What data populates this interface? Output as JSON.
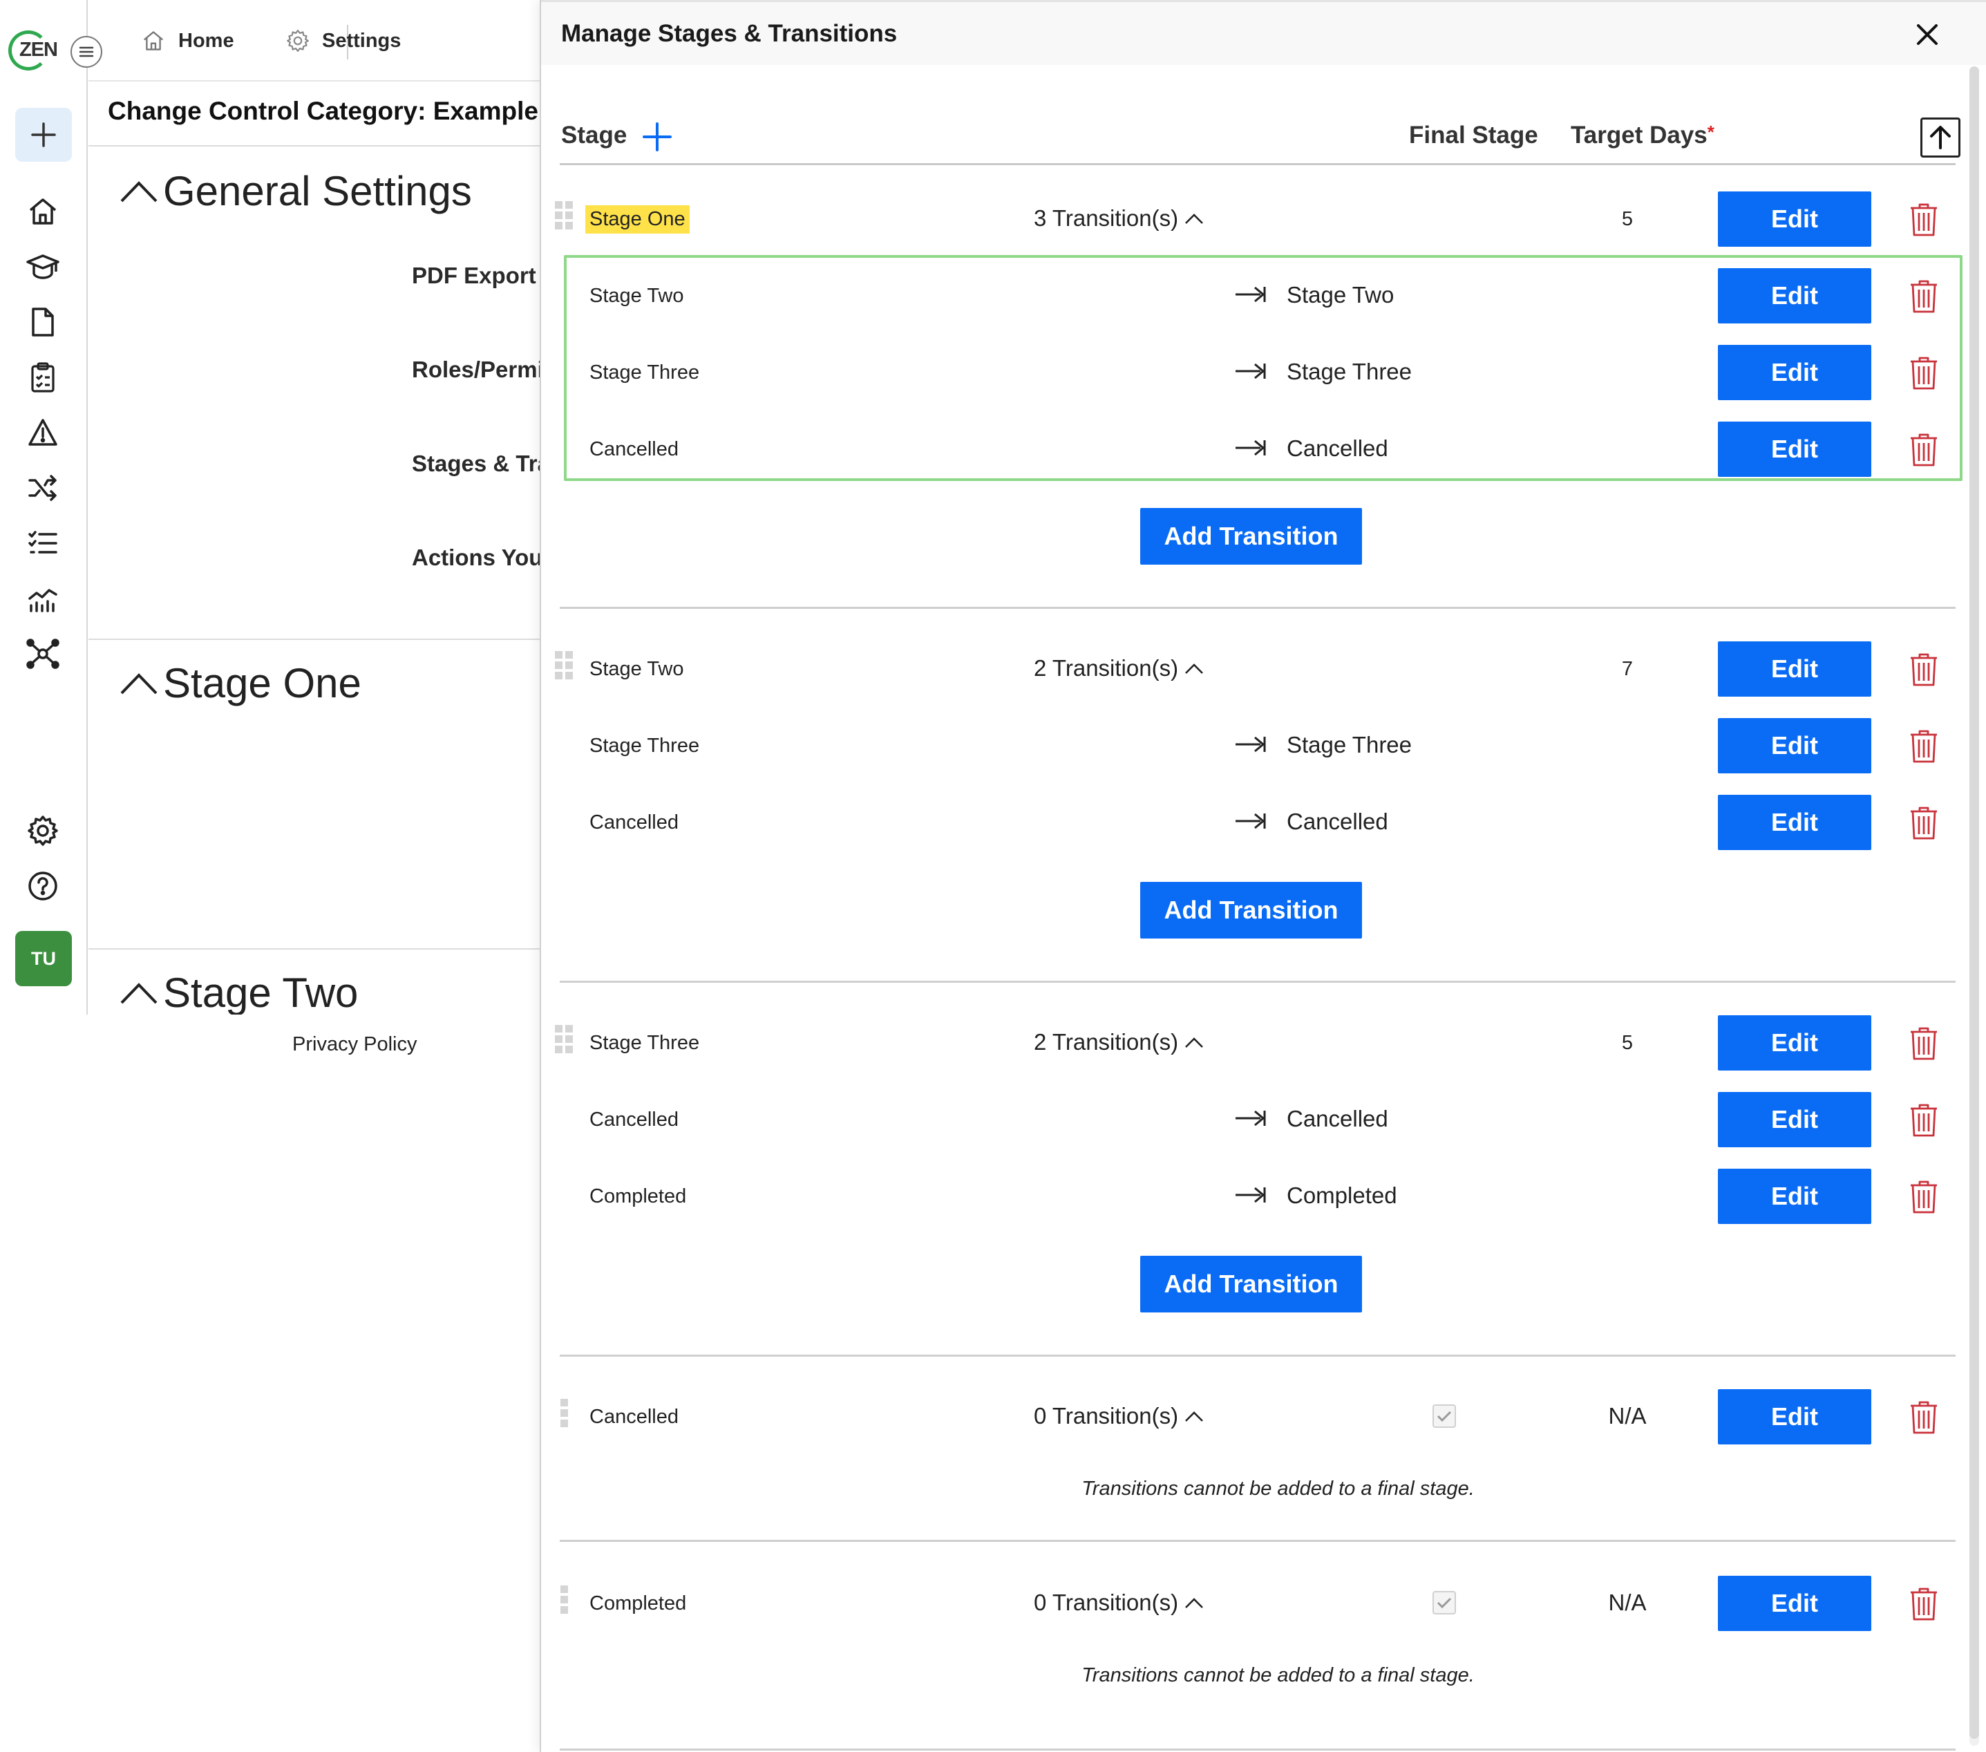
{
  "app": {
    "logo_text": "ZEN",
    "brand_color": "#2fa84f",
    "accent_color": "#0a6cf5",
    "highlight_color": "#ffe24a",
    "user_initials": "TU",
    "rail_icons": [
      "home-icon",
      "graduation-cap-icon",
      "document-icon",
      "clipboard-icon",
      "warning-icon",
      "shuffle-icon",
      "checklist-icon",
      "analytics-icon",
      "network-icon",
      "gear-icon",
      "help-icon"
    ]
  },
  "breadcrumbs": [
    {
      "label": "Home",
      "icon": "home-icon"
    },
    {
      "label": "Settings",
      "icon": "gear-icon"
    }
  ],
  "page": {
    "title": "Change Control Category: Example Cha",
    "sections": [
      {
        "title": "General Settings"
      },
      {
        "title": "Stage One"
      },
      {
        "title": "Stage Two"
      }
    ],
    "settings_items": [
      "PDF Export (",
      "Roles/Permi",
      "Stages & Tra",
      "Actions You"
    ],
    "privacy_policy": "Privacy Policy"
  },
  "modal": {
    "title": "Manage Stages & Transitions",
    "columns": {
      "stage": "Stage",
      "final_stage": "Final Stage",
      "target_days": "Target Days",
      "required_mark": "*"
    },
    "edit_label": "Edit",
    "add_transition_label": "Add Transition",
    "final_stage_note": "Transitions cannot be added to a final stage.",
    "stages": [
      {
        "name": "Stage One",
        "transitions_label": "3 Transition(s)",
        "target_days": "5",
        "final": false,
        "highlighted": true,
        "transitions": [
          {
            "from": "Stage Two",
            "to": "Stage Two"
          },
          {
            "from": "Stage Three",
            "to": "Stage Three"
          },
          {
            "from": "Cancelled",
            "to": "Cancelled"
          }
        ]
      },
      {
        "name": "Stage Two",
        "transitions_label": "2 Transition(s)",
        "target_days": "7",
        "final": false,
        "transitions": [
          {
            "from": "Stage Three",
            "to": "Stage Three"
          },
          {
            "from": "Cancelled",
            "to": "Cancelled"
          }
        ]
      },
      {
        "name": "Stage Three",
        "transitions_label": "2 Transition(s)",
        "target_days": "5",
        "final": false,
        "transitions": [
          {
            "from": "Cancelled",
            "to": "Cancelled"
          },
          {
            "from": "Completed",
            "to": "Completed"
          }
        ]
      },
      {
        "name": "Cancelled",
        "transitions_label": "0 Transition(s)",
        "target_days": "N/A",
        "final": true,
        "transitions": []
      },
      {
        "name": "Completed",
        "transitions_label": "0 Transition(s)",
        "target_days": "N/A",
        "final": true,
        "transitions": []
      }
    ]
  }
}
